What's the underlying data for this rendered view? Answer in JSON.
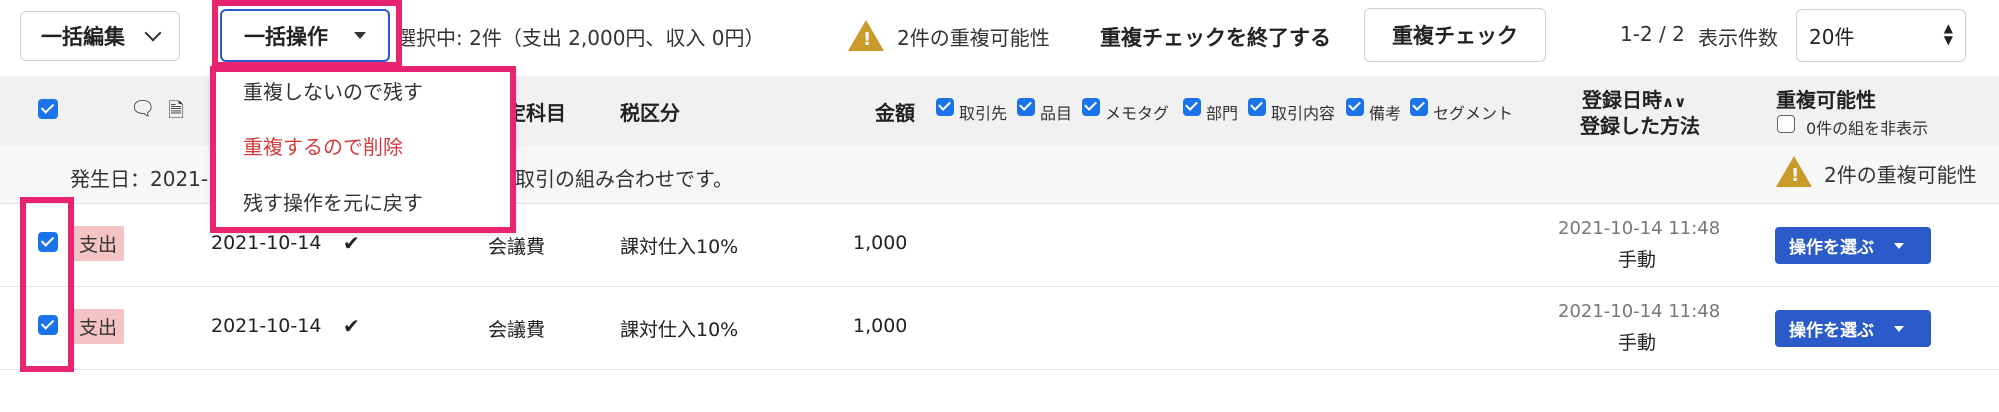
{
  "toolbar": {
    "bulk_edit_label": "一括編集",
    "bulk_action_label": "一括操作",
    "selection_text": "選択中: 2件（支出 2,000円、収入 0円）",
    "duplicate_possibility_text": "2件の重複可能性",
    "end_check_label": "重複チェックを終了する",
    "check_button_label": "重複チェック",
    "pagination": "1-2 / 2",
    "per_page_label": "表示件数",
    "per_page_value": "20件"
  },
  "dropdown": {
    "items": [
      "重複しないので残す",
      "重複するので削除",
      "残す操作を元に戻す"
    ]
  },
  "header": {
    "account_partial": "定科目",
    "tax_category": "税区分",
    "amount": "金額",
    "column_toggles": [
      "取引先",
      "品目",
      "メモタグ",
      "部門",
      "取引内容",
      "備考",
      "セグメント"
    ],
    "registered_at": "登録日時",
    "registered_method": "登録した方法",
    "duplicate_possibility": "重複可能性",
    "hide_zero_label": "0件の組を非表示"
  },
  "group": {
    "text_left": "発生日：2021-",
    "text_right": "取引の組み合わせです。",
    "duplicate_text": "2件の重複可能性"
  },
  "rows": [
    {
      "type": "支出",
      "date": "2021-10-14",
      "account": "会議費",
      "tax": "課対仕入10%",
      "amount": "1,000",
      "registered_at": "2021-10-14 11:48",
      "method": "手動",
      "action_label": "操作を選ぶ"
    },
    {
      "type": "支出",
      "date": "2021-10-14",
      "account": "会議費",
      "tax": "課対仕入10%",
      "amount": "1,000",
      "registered_at": "2021-10-14 11:48",
      "method": "手動",
      "action_label": "操作を選ぶ"
    }
  ],
  "colors": {
    "accent": "#1a73e8",
    "highlight": "#e8236f",
    "delete_text": "#d33c3c",
    "warning": "#c89b2a",
    "expense_tag": "#f4c4c4",
    "action_button": "#2a5bc9"
  }
}
